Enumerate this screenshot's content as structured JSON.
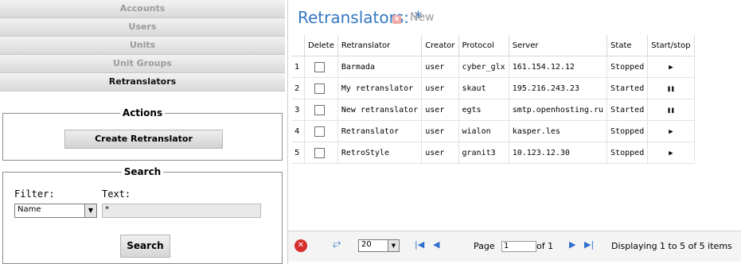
{
  "nav": {
    "items": [
      {
        "label": "Accounts",
        "active": false
      },
      {
        "label": "Users",
        "active": false
      },
      {
        "label": "Units",
        "active": false
      },
      {
        "label": "Unit Groups",
        "active": false
      },
      {
        "label": "Retranslators",
        "active": true
      }
    ]
  },
  "actions": {
    "legend": "Actions",
    "create_label": "Create Retranslator"
  },
  "search": {
    "legend": "Search",
    "filter_label": "Filter:",
    "text_label": "Text:",
    "filter_value": "Name",
    "text_value": "*",
    "button_label": "Search"
  },
  "header": {
    "title": "Retranslators:",
    "title_suffix": "*",
    "close_icon": "x-icon",
    "new_label": "New"
  },
  "table": {
    "columns": [
      "",
      "Delete",
      "Retranslator",
      "Creator",
      "Protocol",
      "Server",
      "State",
      "Start/stop"
    ],
    "rows": [
      {
        "num": "1",
        "name": "Barmada",
        "creator": "user",
        "protocol": "cyber_glx",
        "server": "161.154.12.12",
        "state": "Stopped",
        "action": "play"
      },
      {
        "num": "2",
        "name": "My retranslator",
        "creator": "user",
        "protocol": "skaut",
        "server": "195.216.243.23",
        "state": "Started",
        "action": "pause"
      },
      {
        "num": "3",
        "name": "New retranslator",
        "creator": "user",
        "protocol": "egts",
        "server": "smtp.openhosting.ru",
        "state": "Started",
        "action": "pause"
      },
      {
        "num": "4",
        "name": "Retranslator",
        "creator": "user",
        "protocol": "wialon",
        "server": "kasper.les",
        "state": "Stopped",
        "action": "play"
      },
      {
        "num": "5",
        "name": "RetroStyle",
        "creator": "user",
        "protocol": "granit3",
        "server": "10.123.12.30",
        "state": "Stopped",
        "action": "play"
      }
    ]
  },
  "pager": {
    "page_size": "20",
    "page_label": "Page",
    "page_value": "1",
    "of_label": "of 1",
    "display_text": "Displaying 1 to 5 of 5 items"
  },
  "colors": {
    "title": "#3377c1",
    "stop_icon": "#d62d2d",
    "nav_arrow": "#2e6fcd"
  }
}
